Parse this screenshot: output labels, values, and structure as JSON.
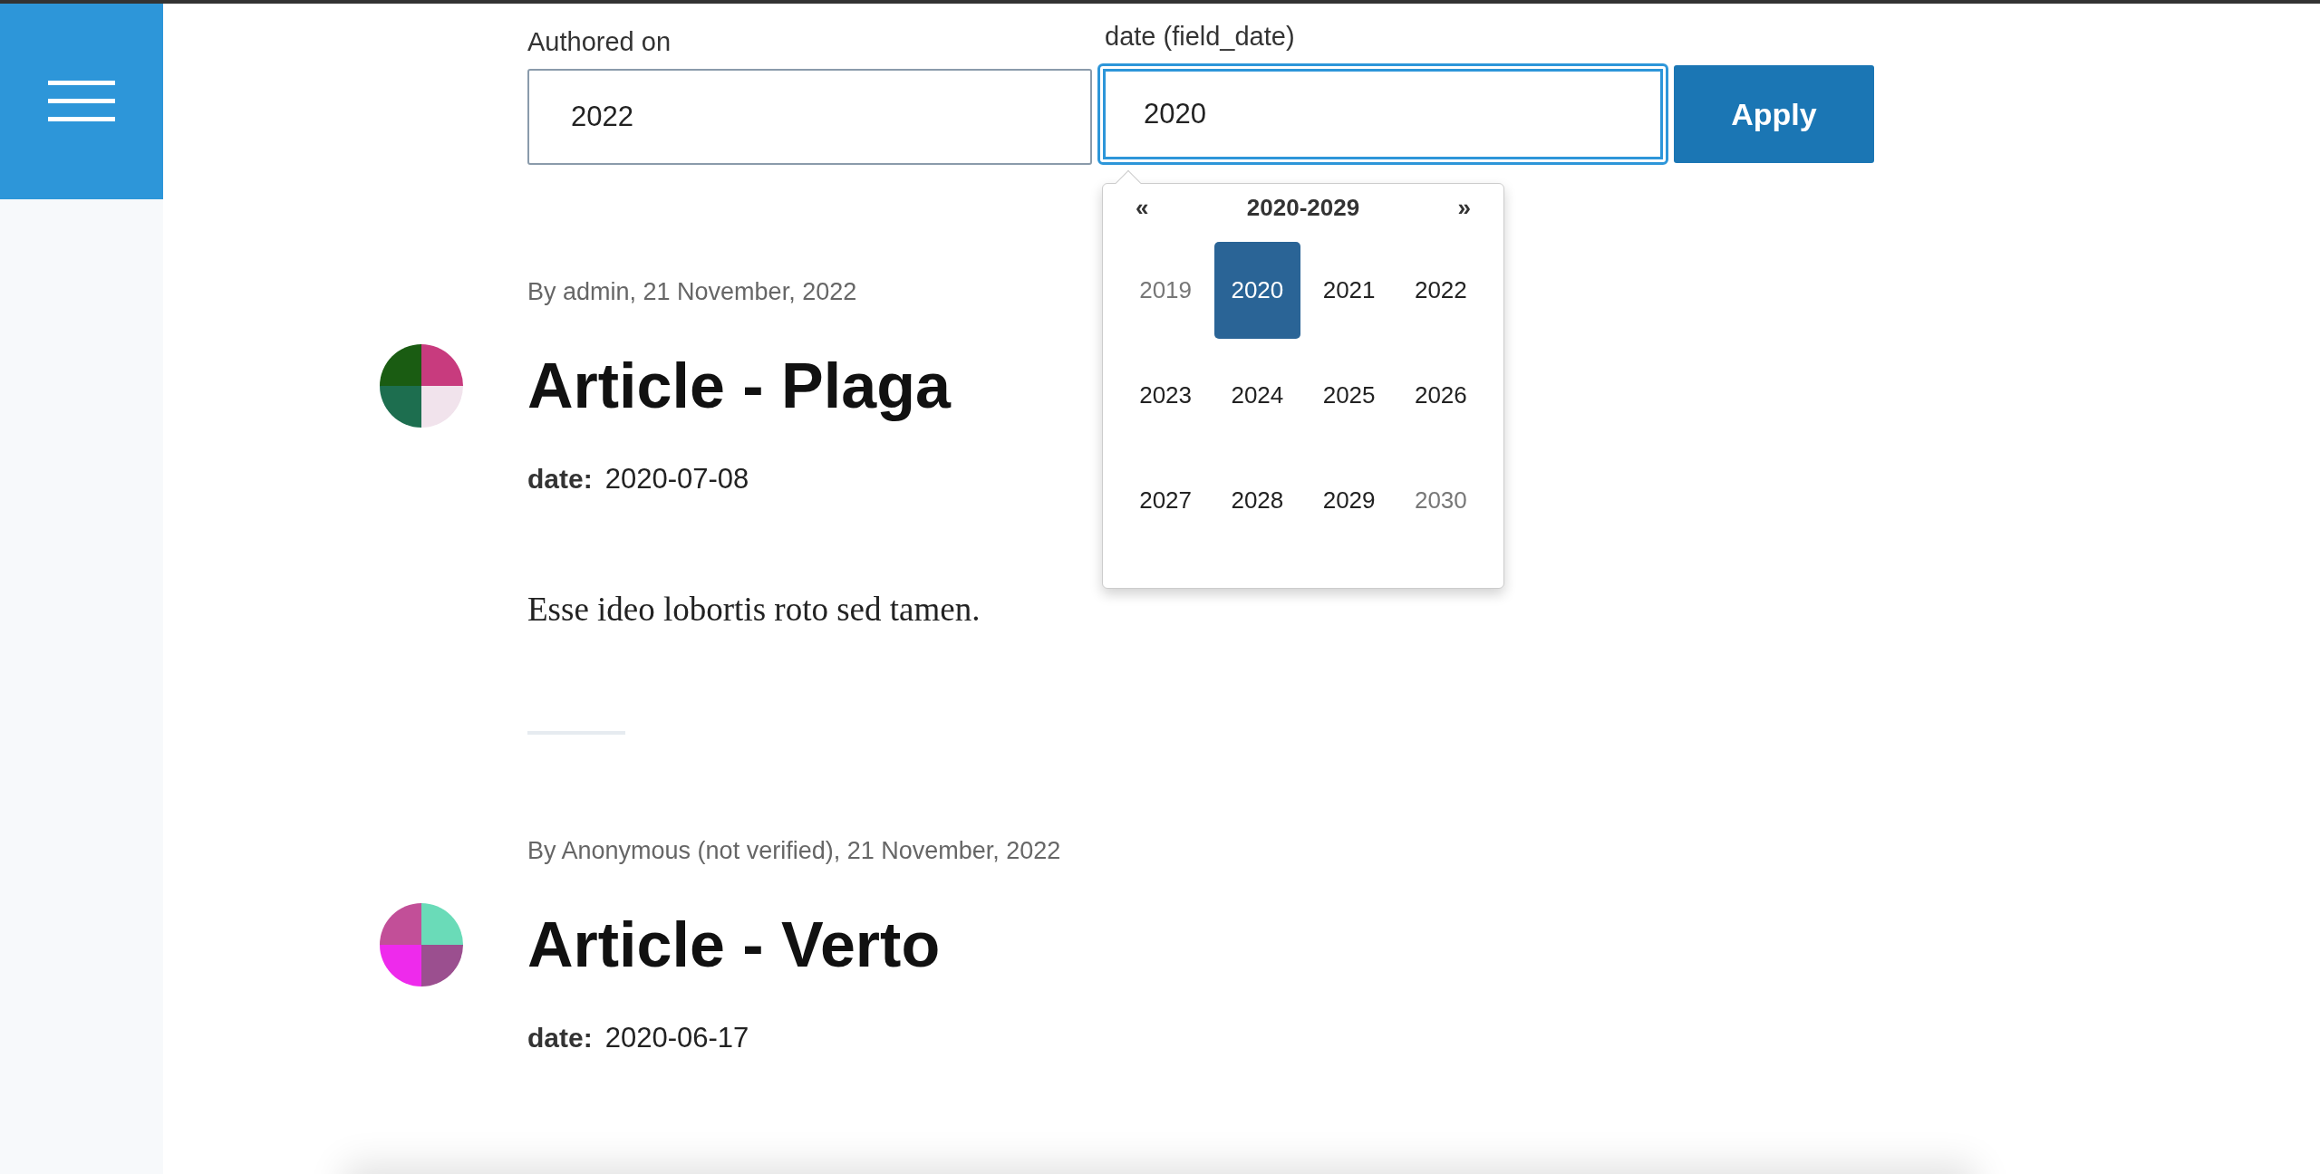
{
  "filters": [
    {
      "label": "Authored on",
      "value": "2022",
      "focused": false
    },
    {
      "label": "date (field_date)",
      "value": "2020",
      "focused": true
    }
  ],
  "apply_button": "Apply",
  "year_picker": {
    "prev": "«",
    "range": "2020-2029",
    "next": "»",
    "years": [
      {
        "label": "2019",
        "selected": false,
        "outside_range": true
      },
      {
        "label": "2020",
        "selected": true,
        "outside_range": false
      },
      {
        "label": "2021",
        "selected": false,
        "outside_range": false
      },
      {
        "label": "2022",
        "selected": false,
        "outside_range": false
      },
      {
        "label": "2023",
        "selected": false,
        "outside_range": false
      },
      {
        "label": "2024",
        "selected": false,
        "outside_range": false
      },
      {
        "label": "2025",
        "selected": false,
        "outside_range": false
      },
      {
        "label": "2026",
        "selected": false,
        "outside_range": false
      },
      {
        "label": "2027",
        "selected": false,
        "outside_range": false
      },
      {
        "label": "2028",
        "selected": false,
        "outside_range": false
      },
      {
        "label": "2029",
        "selected": false,
        "outside_range": false
      },
      {
        "label": "2030",
        "selected": false,
        "outside_range": true
      }
    ]
  },
  "articles": [
    {
      "meta": "By admin, 21 November, 2022",
      "title": "Article - Plaga",
      "date_label": "date:",
      "date": "2020-07-08",
      "body": "Esse ideo lobortis roto sed tamen.",
      "avatar": [
        {
          "color": "#1a5c12"
        },
        {
          "color": "#c83b7e"
        },
        {
          "color": "#1d6e4f"
        },
        {
          "color": "#f1e3ec"
        }
      ]
    },
    {
      "meta": "By Anonymous (not verified), 21 November, 2022",
      "title": "Article - Verto",
      "date_label": "date:",
      "date": "2020-06-17",
      "avatar": [
        {
          "color": "#c24f98"
        },
        {
          "color": "#6adbb8"
        },
        {
          "color": "#ee2aec"
        },
        {
          "color": "#9b4f8f"
        }
      ]
    }
  ]
}
